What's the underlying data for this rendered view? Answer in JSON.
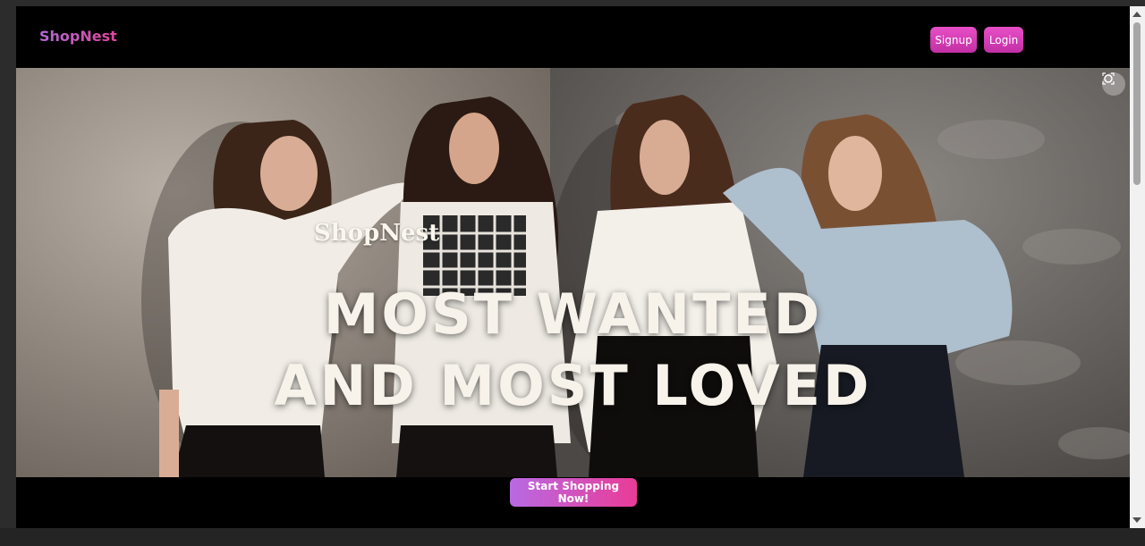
{
  "header": {
    "brand": "ShopNest",
    "signup_label": "Signup",
    "login_label": "Login"
  },
  "hero": {
    "brand_overlay": "ShopNest",
    "headline_line1": "MOST WANTED",
    "headline_line2": "AND MOST LOVED",
    "image_icon": "focus-lens-icon"
  },
  "cta": {
    "label": "Start Shopping Now!"
  },
  "colors": {
    "brand_gradient_start": "#b06ad6",
    "brand_gradient_end": "#e0459d",
    "button_pink": "#e84fc7",
    "cta_gradient_start": "#b86ae3",
    "cta_gradient_end": "#ea3b97",
    "page_background": "#000000"
  }
}
